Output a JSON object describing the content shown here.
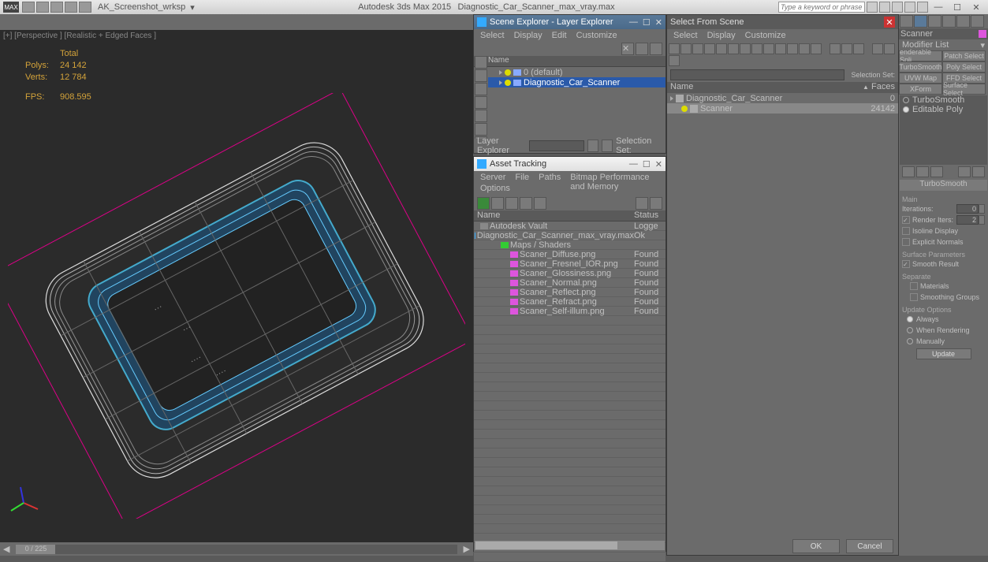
{
  "titlebar": {
    "workspace": "AK_Screenshot_wrksp",
    "app": "Autodesk 3ds Max 2015",
    "file": "Diagnostic_Car_Scanner_max_vray.max",
    "search_placeholder": "Type a keyword or phrase"
  },
  "viewport": {
    "label": "[+] [Perspective ] [Realistic + Edged Faces ]",
    "stats": {
      "total_label": "Total",
      "polys_label": "Polys:",
      "polys": "24 142",
      "verts_label": "Verts:",
      "verts": "12 784",
      "fps_label": "FPS:",
      "fps": "908.595"
    }
  },
  "scene_explorer": {
    "title": "Scene Explorer - Layer Explorer",
    "menu": [
      "Select",
      "Display",
      "Edit",
      "Customize"
    ],
    "name_col": "Name",
    "items": [
      {
        "label": "0 (default)",
        "indent": 0,
        "sel": false
      },
      {
        "label": "Diagnostic_Car_Scanner",
        "indent": 0,
        "sel": true
      }
    ],
    "bottom_label": "Layer Explorer",
    "selset_label": "Selection Set:"
  },
  "asset_tracking": {
    "title": "Asset Tracking",
    "menu1": [
      "Server",
      "File",
      "Paths",
      "Bitmap Performance and Memory"
    ],
    "menu2": "Options",
    "cols": [
      "Name",
      "Status"
    ],
    "rows": [
      {
        "pad": 8,
        "icon": "vault",
        "name": "Autodesk Vault",
        "status": "Logge"
      },
      {
        "pad": 20,
        "icon": "max",
        "name": "Diagnostic_Car_Scanner_max_vray.max",
        "status": "Ok"
      },
      {
        "pad": 34,
        "icon": "grp",
        "name": "Maps / Shaders",
        "status": ""
      },
      {
        "pad": 46,
        "icon": "png",
        "name": "Scaner_Diffuse.png",
        "status": "Found"
      },
      {
        "pad": 46,
        "icon": "png",
        "name": "Scaner_Fresnel_IOR.png",
        "status": "Found"
      },
      {
        "pad": 46,
        "icon": "png",
        "name": "Scaner_Glossiness.png",
        "status": "Found"
      },
      {
        "pad": 46,
        "icon": "png",
        "name": "Scaner_Normal.png",
        "status": "Found"
      },
      {
        "pad": 46,
        "icon": "png",
        "name": "Scaner_Reflect.png",
        "status": "Found"
      },
      {
        "pad": 46,
        "icon": "png",
        "name": "Scaner_Refract.png",
        "status": "Found"
      },
      {
        "pad": 46,
        "icon": "png",
        "name": "Scaner_Self-illum.png",
        "status": "Found"
      }
    ]
  },
  "select_from_scene": {
    "title": "Select From Scene",
    "menu": [
      "Select",
      "Display",
      "Customize"
    ],
    "selset_label": "Selection Set:",
    "cols": [
      "Name",
      "Faces"
    ],
    "rows": [
      {
        "name": "Diagnostic_Car_Scanner",
        "faces": "0",
        "sel": false
      },
      {
        "name": "Scanner",
        "faces": "24142",
        "sel": true
      }
    ],
    "ok": "OK",
    "cancel": "Cancel"
  },
  "modifier": {
    "obj_name": "Scanner",
    "list_label": "Modifier List",
    "buttons": [
      "enderable Spli",
      "Patch Select",
      "TurboSmooth",
      "Poly Select",
      "UVW Map",
      "FFD Select",
      "XForm",
      "Surface Select"
    ],
    "stack": [
      {
        "label": "TurboSmooth",
        "on": false
      },
      {
        "label": "Editable Poly",
        "on": true
      }
    ],
    "rollout_title": "TurboSmooth",
    "main_label": "Main",
    "iterations_label": "Iterations:",
    "iterations": "0",
    "render_iters_label": "Render Iters:",
    "render_iters": "2",
    "isoline": "Isoline Display",
    "explicit": "Explicit Normals",
    "surf_params": "Surface Parameters",
    "smooth_result": "Smooth Result",
    "separate": "Separate",
    "materials": "Materials",
    "smoothing_groups": "Smoothing Groups",
    "update_options": "Update Options",
    "always": "Always",
    "when_rendering": "When Rendering",
    "manually": "Manually",
    "update_btn": "Update"
  },
  "bottom": {
    "frame": "0 / 225"
  }
}
